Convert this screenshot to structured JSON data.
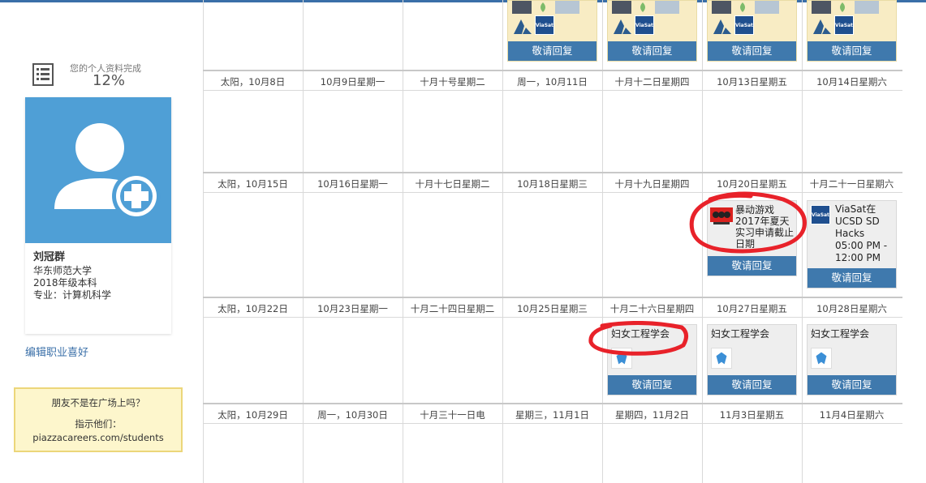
{
  "sidebar": {
    "progress_label": "您的个人资料完成",
    "progress_value": "12%",
    "progress_fraction": 0.12,
    "profile": {
      "name": "刘冠群",
      "school": "华东师范大学",
      "class_year": "2018年级本科",
      "major": "专业：计算机科学"
    },
    "edit_link": "编辑职业喜好",
    "invite": {
      "question": "朋友不是在广场上吗？",
      "instruction": "指示他们：",
      "url": "piazzacareers.com/students"
    }
  },
  "calendar": {
    "reply_label": "敬请回复",
    "weeks": [
      {
        "days": [
          "太阳，10月8日",
          "10月9日星期一",
          "十月十号星期二",
          "周一，10月11日",
          "十月十二日星期四",
          "10月13日星期五",
          "10月14日星期六"
        ]
      },
      {
        "days": [
          "太阳，10月15日",
          "10月16日星期一",
          "十月十七日星期二",
          "10月18日星期三",
          "十月十九日星期四",
          "10月20日星期五",
          "十月二十一日星期六"
        ]
      },
      {
        "days": [
          "太阳，10月22日",
          "10月23日星期一",
          "十月二十四日星期二",
          "10月25日星期三",
          "十月二十六日星期四",
          "10月27日星期五",
          "10月28日星期六"
        ]
      },
      {
        "days": [
          "太阳，10月29日",
          "周一，10月30日",
          "十月三十一日电",
          "星期三，11月1日",
          "星期四，11月2日",
          "11月3日星期五",
          "11月4日星期六"
        ]
      }
    ],
    "events": {
      "blizzard_title": "暴动游戏2017年夏天实习申请截止日期",
      "viasat_title": "ViaSat在UCSD SD Hacks",
      "viasat_time": "05:00 PM - 12:00 PM",
      "swe_title": "妇女工程学会"
    },
    "logos": {
      "viasat_text": "ViaSat"
    }
  },
  "colors": {
    "accent": "#3f79ad",
    "avatar_bg": "#4f9fd6",
    "invite_bg": "#fdf6cc",
    "annotation": "#e8222a"
  }
}
